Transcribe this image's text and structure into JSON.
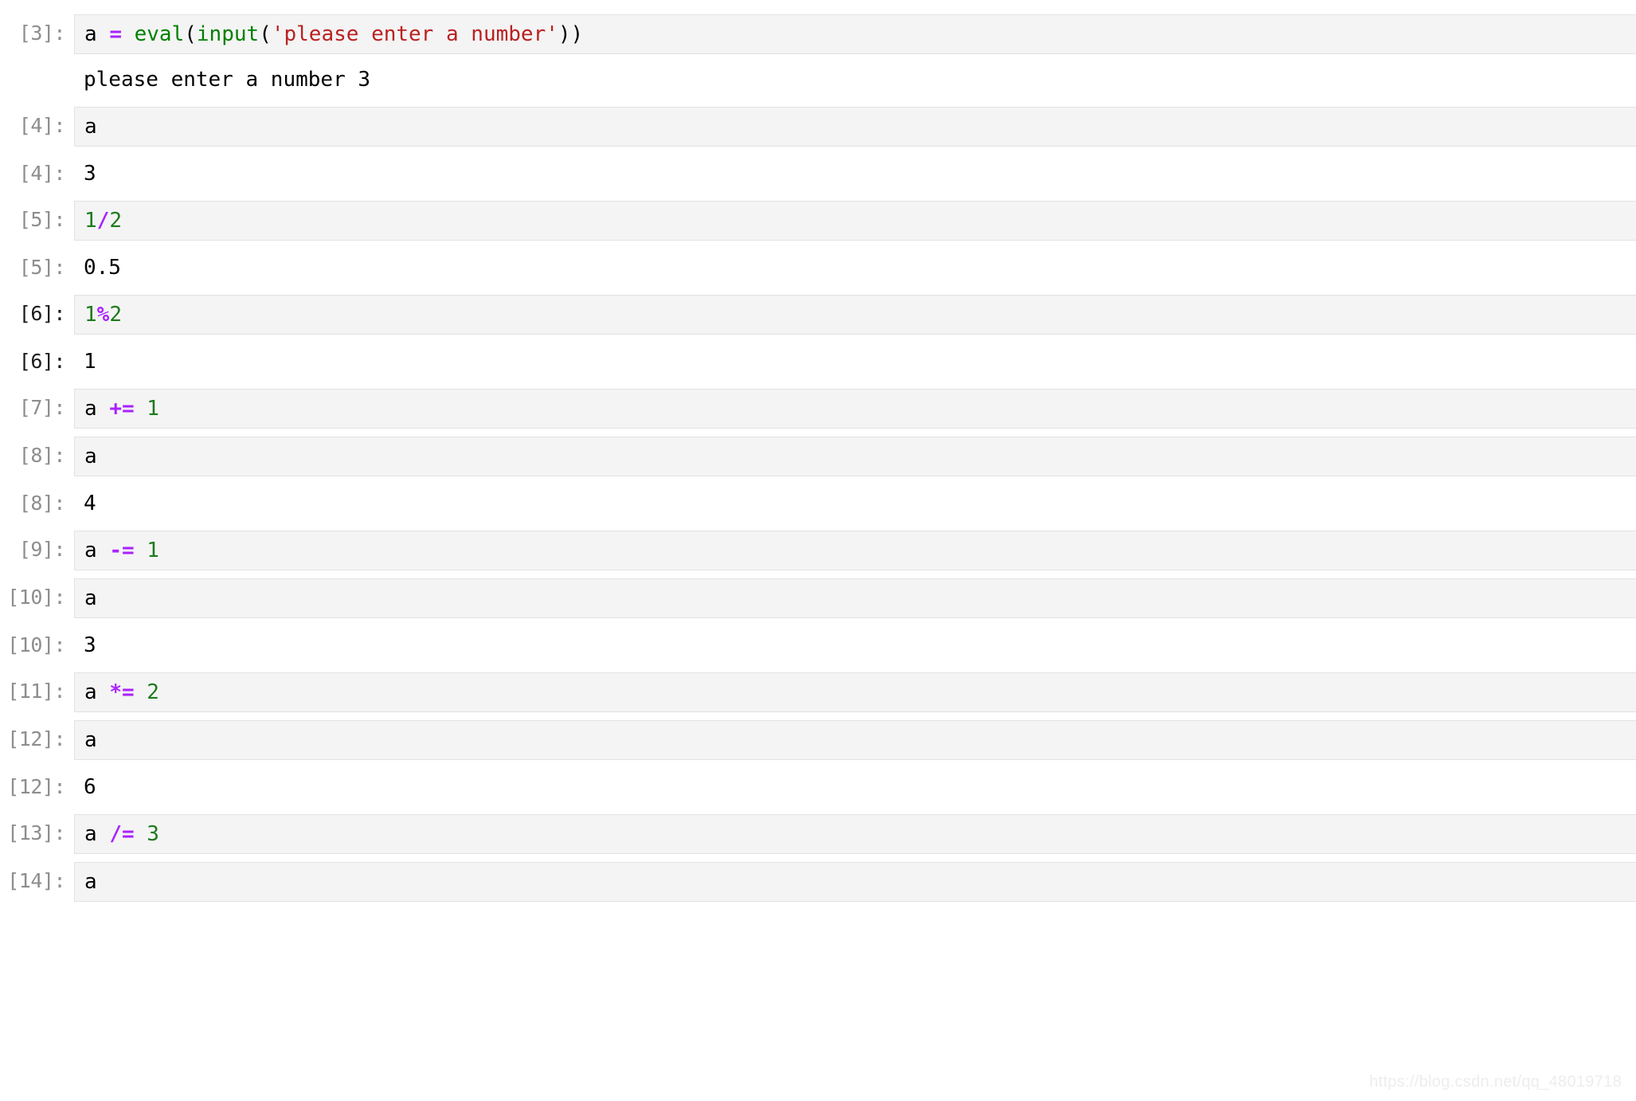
{
  "notebook": {
    "theme_colors": {
      "input_background": "#f4f4f4",
      "input_border": "#e2e2e2",
      "page_background": "#ffffff",
      "prompt_color": "#8d8d8d",
      "operator_color": "#aa22ff",
      "number_color": "#1d7a1d",
      "string_color": "#ba2121",
      "builtin_color": "#008000",
      "text_color": "#000000",
      "watermark_color": "#ededed"
    },
    "cells": [
      {
        "type": "input",
        "prompt": "[3]:",
        "prompt_style": "normal",
        "tokens": [
          {
            "t": "a ",
            "c": "pln"
          },
          {
            "t": "=",
            "c": "op"
          },
          {
            "t": " ",
            "c": "pln"
          },
          {
            "t": "eval",
            "c": "bif"
          },
          {
            "t": "(",
            "c": "pln"
          },
          {
            "t": "input",
            "c": "bif"
          },
          {
            "t": "(",
            "c": "pln"
          },
          {
            "t": "'please enter a number'",
            "c": "str"
          },
          {
            "t": "))",
            "c": "pln"
          }
        ],
        "plain": "a = eval(input('please enter a number'))"
      },
      {
        "type": "stream",
        "prompt": "",
        "prompt_style": "blank",
        "text": "please enter a number 3"
      },
      {
        "type": "input",
        "prompt": "[4]:",
        "prompt_style": "normal",
        "tokens": [
          {
            "t": "a",
            "c": "pln"
          }
        ],
        "plain": "a"
      },
      {
        "type": "output",
        "prompt": "[4]:",
        "prompt_style": "normal",
        "text": "3"
      },
      {
        "type": "input",
        "prompt": "[5]:",
        "prompt_style": "normal",
        "tokens": [
          {
            "t": "1",
            "c": "num"
          },
          {
            "t": "/",
            "c": "op"
          },
          {
            "t": "2",
            "c": "num"
          }
        ],
        "plain": "1/2"
      },
      {
        "type": "output",
        "prompt": "[5]:",
        "prompt_style": "normal",
        "text": "0.5"
      },
      {
        "type": "input",
        "prompt": "[6]:",
        "prompt_style": "dark",
        "tokens": [
          {
            "t": "1",
            "c": "num"
          },
          {
            "t": "%",
            "c": "op"
          },
          {
            "t": "2",
            "c": "num"
          }
        ],
        "plain": "1%2"
      },
      {
        "type": "output",
        "prompt": "[6]:",
        "prompt_style": "dark",
        "text": "1"
      },
      {
        "type": "input",
        "prompt": "[7]:",
        "prompt_style": "normal",
        "tokens": [
          {
            "t": "a ",
            "c": "pln"
          },
          {
            "t": "+=",
            "c": "op"
          },
          {
            "t": " ",
            "c": "pln"
          },
          {
            "t": "1",
            "c": "num"
          }
        ],
        "plain": "a += 1"
      },
      {
        "type": "input",
        "prompt": "[8]:",
        "prompt_style": "normal",
        "tokens": [
          {
            "t": "a",
            "c": "pln"
          }
        ],
        "plain": "a"
      },
      {
        "type": "output",
        "prompt": "[8]:",
        "prompt_style": "normal",
        "text": "4"
      },
      {
        "type": "input",
        "prompt": "[9]:",
        "prompt_style": "normal",
        "tokens": [
          {
            "t": "a ",
            "c": "pln"
          },
          {
            "t": "-=",
            "c": "op"
          },
          {
            "t": " ",
            "c": "pln"
          },
          {
            "t": "1",
            "c": "num"
          }
        ],
        "plain": "a -= 1"
      },
      {
        "type": "input",
        "prompt": "[10]:",
        "prompt_style": "normal",
        "tokens": [
          {
            "t": "a",
            "c": "pln"
          }
        ],
        "plain": "a"
      },
      {
        "type": "output",
        "prompt": "[10]:",
        "prompt_style": "normal",
        "text": "3"
      },
      {
        "type": "input",
        "prompt": "[11]:",
        "prompt_style": "normal",
        "tokens": [
          {
            "t": "a ",
            "c": "pln"
          },
          {
            "t": "*=",
            "c": "op"
          },
          {
            "t": " ",
            "c": "pln"
          },
          {
            "t": "2",
            "c": "num"
          }
        ],
        "plain": "a *= 2"
      },
      {
        "type": "input",
        "prompt": "[12]:",
        "prompt_style": "normal",
        "tokens": [
          {
            "t": "a",
            "c": "pln"
          }
        ],
        "plain": "a"
      },
      {
        "type": "output",
        "prompt": "[12]:",
        "prompt_style": "normal",
        "text": "6"
      },
      {
        "type": "input",
        "prompt": "[13]:",
        "prompt_style": "normal",
        "tokens": [
          {
            "t": "a ",
            "c": "pln"
          },
          {
            "t": "/=",
            "c": "op"
          },
          {
            "t": " ",
            "c": "pln"
          },
          {
            "t": "3",
            "c": "num"
          }
        ],
        "plain": "a /= 3"
      },
      {
        "type": "input",
        "prompt": "[14]:",
        "prompt_style": "normal",
        "tokens": [
          {
            "t": "a",
            "c": "pln"
          }
        ],
        "plain": "a"
      }
    ]
  },
  "watermark": {
    "text": "https://blog.csdn.net/qq_48019718"
  }
}
